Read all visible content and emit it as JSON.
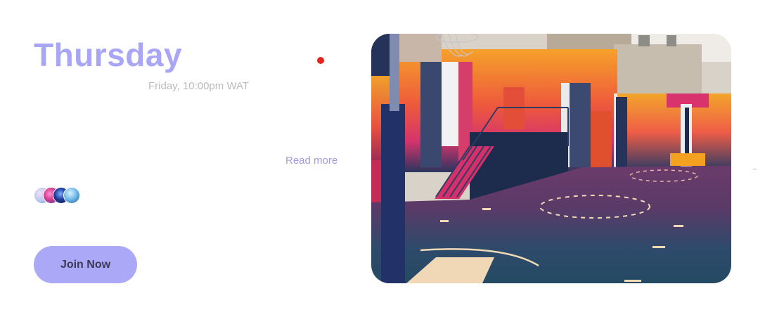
{
  "event": {
    "title": "Thursday",
    "schedule": "Friday, 10:00pm WAT",
    "read_more_label": "Read more",
    "join_label": "Join Now"
  },
  "image": {
    "subject": "colorful outdoor basketball court",
    "palette": {
      "navy": "#25335a",
      "orange": "#f08a2c",
      "magenta": "#e0306e",
      "court_floor": "#5a3e6e",
      "wall": "#c9c0b4"
    }
  },
  "colors": {
    "title": "#a9a6f7",
    "accent_button": "#aba8f8",
    "live_indicator": "#e5231b",
    "link": "#9e9ae6",
    "muted_text": "#b9b9bf"
  }
}
